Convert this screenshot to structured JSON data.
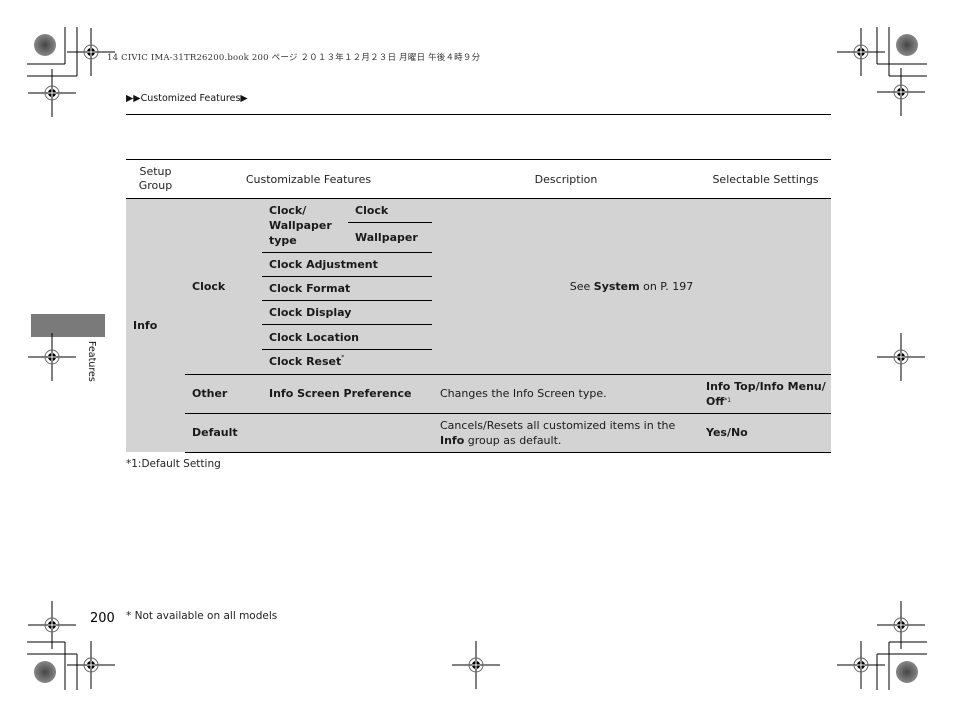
{
  "print_header": "14 CIVIC IMA-31TR26200.book  200 ページ  ２０１３年１２月２３日  月曜日  午後４時９分",
  "breadcrumb": {
    "prefix_icon": "double-triangle-right-icon",
    "label": "Customized Features",
    "suffix_icon": "triangle-right-icon"
  },
  "side_tab": {
    "label": "Features"
  },
  "table": {
    "headers": {
      "setup_group": "Setup Group",
      "customizable_features": "Customizable Features",
      "description": "Description",
      "selectable_settings": "Selectable Settings"
    },
    "group": "Info",
    "clock": {
      "category": "Clock",
      "wallpaper_group": "Clock/ Wallpaper type",
      "wallpaper_items": [
        "Clock",
        "Wallpaper"
      ],
      "items": [
        "Clock Adjustment",
        "Clock Format",
        "Clock Display",
        "Clock Location",
        "Clock Reset"
      ],
      "clock_reset_mark": "*",
      "description_prefix": "See ",
      "description_link": "System",
      "description_suffix": " on  P. 197"
    },
    "other": {
      "category": "Other",
      "feature": "Info Screen Preference",
      "description": "Changes the Info Screen type.",
      "settings": "Info Top/Info Menu/ Off",
      "settings_note": "*1"
    },
    "default": {
      "category": "Default",
      "description_prefix": "Cancels/Resets all customized items in the ",
      "description_bold": "Info",
      "description_suffix": " group as default.",
      "settings": "Yes/No"
    }
  },
  "table_footnote": "*1:Default Setting",
  "page_number": "200",
  "page_footnote": "* Not available on all models",
  "colors": {
    "table_fill": "#d3d3d3",
    "side_tab": "#7a7a7a"
  }
}
